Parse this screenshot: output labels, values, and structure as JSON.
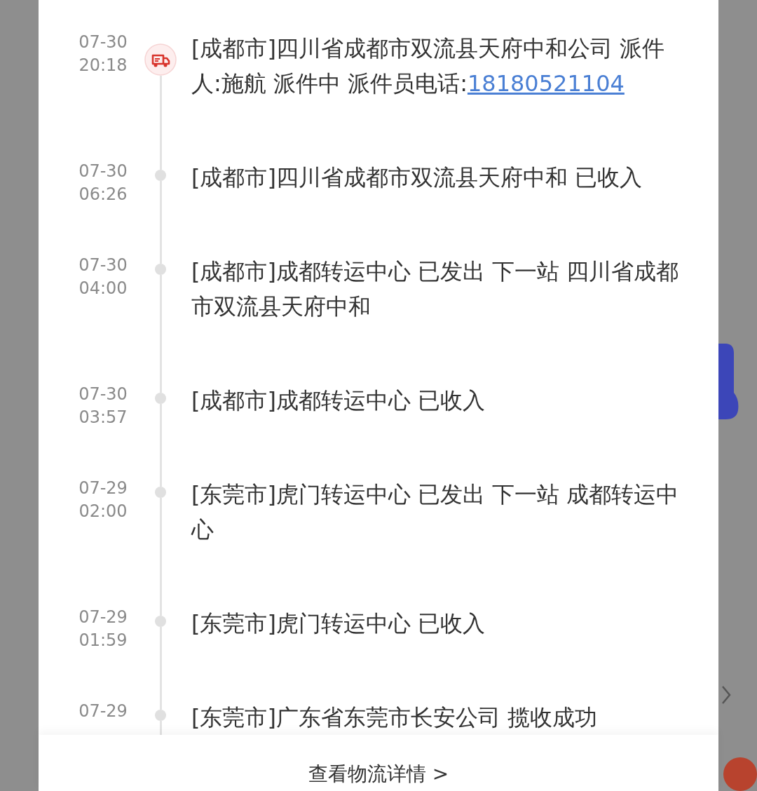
{
  "events": [
    {
      "date": "07-30",
      "time": "20:18",
      "text": "[成都市]四川省成都市双流县天府中和公司 派件人:施航 派件中 派件员电话:",
      "phone": "18180521104",
      "current": true
    },
    {
      "date": "07-30",
      "time": "06:26",
      "text": "[成都市]四川省成都市双流县天府中和 已收入",
      "current": false
    },
    {
      "date": "07-30",
      "time": "04:00",
      "text": "[成都市]成都转运中心 已发出 下一站  四川省成都市双流县天府中和",
      "current": false
    },
    {
      "date": "07-30",
      "time": "03:57",
      "text": "[成都市]成都转运中心 已收入",
      "current": false
    },
    {
      "date": "07-29",
      "time": "02:00",
      "text": "[东莞市]虎门转运中心 已发出 下一站  成都转运中心",
      "current": false
    },
    {
      "date": "07-29",
      "time": "01:59",
      "text": "[东莞市]虎门转运中心 已收入",
      "current": false
    },
    {
      "date": "07-29",
      "text": "[东莞市]广东省东莞市长安公司 揽收成功",
      "current": false
    }
  ],
  "footer_link": "查看物流详情 >"
}
